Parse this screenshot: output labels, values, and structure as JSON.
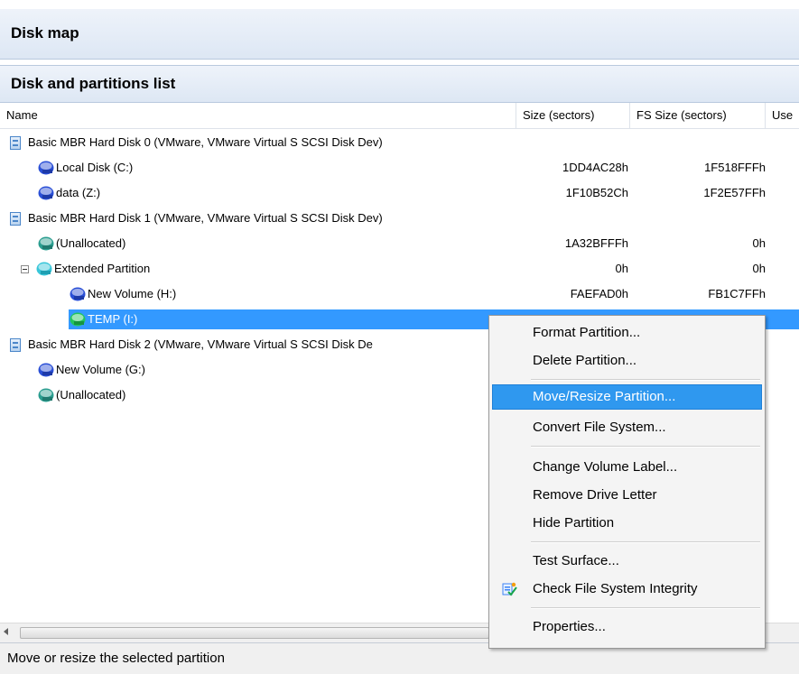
{
  "headers": {
    "disk_map": "Disk map",
    "partitions_list": "Disk and partitions list"
  },
  "columns": {
    "name": "Name",
    "size": "Size (sectors)",
    "fs_size": "FS Size (sectors)",
    "used": "Use"
  },
  "rows": [
    {
      "kind": "disk",
      "name": "Basic MBR Hard Disk 0 (VMware, VMware Virtual S SCSI Disk Dev)",
      "size": "",
      "fs": ""
    },
    {
      "kind": "partition",
      "name": "Local Disk (C:)",
      "size": "1DD4AC28h",
      "fs": "1F518FFFh"
    },
    {
      "kind": "partition",
      "name": "data (Z:)",
      "size": "1F10B52Ch",
      "fs": "1F2E57FFh"
    },
    {
      "kind": "disk",
      "name": "Basic MBR Hard Disk 1 (VMware, VMware Virtual S SCSI Disk Dev)",
      "size": "",
      "fs": ""
    },
    {
      "kind": "unallocated",
      "name": "(Unallocated)",
      "size": "1A32BFFFh",
      "fs": "0h"
    },
    {
      "kind": "extended",
      "name": "Extended Partition",
      "size": "0h",
      "fs": "0h"
    },
    {
      "kind": "partition",
      "name": "New Volume (H:)",
      "size": "FAEFAD0h",
      "fs": "FB1C7FFh"
    },
    {
      "kind": "partition-selected",
      "name": "TEMP (I:)",
      "size": "",
      "fs": ""
    },
    {
      "kind": "disk",
      "name": "Basic MBR Hard Disk 2 (VMware, VMware Virtual S SCSI Disk De",
      "size": "",
      "fs": ""
    },
    {
      "kind": "partition",
      "name": "New Volume (G:)",
      "size": "",
      "fs": ""
    },
    {
      "kind": "unallocated",
      "name": "(Unallocated)",
      "size": "",
      "fs": ""
    }
  ],
  "context_menu": {
    "items": [
      {
        "label": "Format Partition..."
      },
      {
        "label": "Delete Partition..."
      },
      {
        "label": "Move/Resize Partition...",
        "highlighted": true
      },
      {
        "label": "Convert File System..."
      },
      {
        "label": "Change Volume Label..."
      },
      {
        "label": "Remove Drive Letter"
      },
      {
        "label": "Hide Partition"
      },
      {
        "label": "Test Surface..."
      },
      {
        "label": "Check File System Integrity",
        "icon": "check-fs-icon"
      },
      {
        "label": "Properties..."
      }
    ]
  },
  "status_bar": {
    "text": "Move or resize the selected partition"
  },
  "colors": {
    "selection": "#3399ff",
    "menu_highlight": "#2f98ef",
    "partition_blue": "#2a4fd6",
    "partition_teal": "#2a9d8f",
    "partition_green": "#22c55e",
    "partition_cyan": "#38c6d9"
  }
}
